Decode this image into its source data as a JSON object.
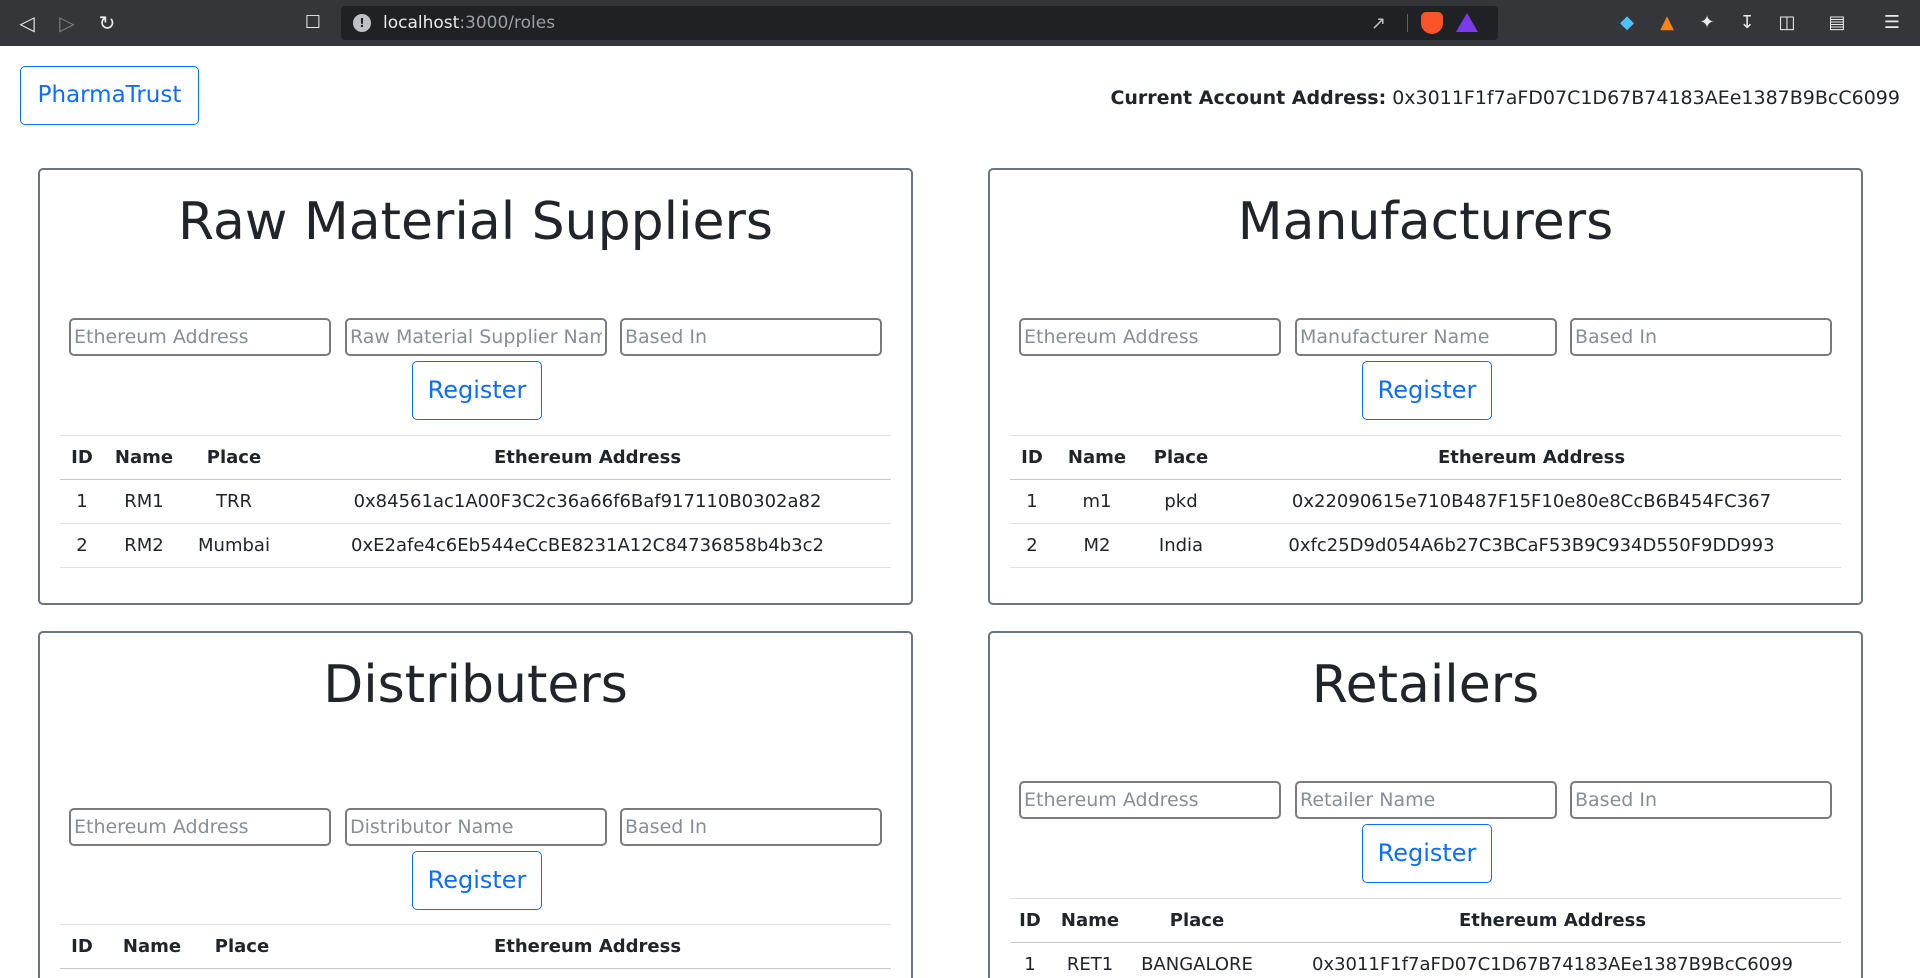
{
  "browser": {
    "url_host": "localhost",
    "url_path": ":3000/roles"
  },
  "header": {
    "brand": "PharmaTrust",
    "account_label": "Current Account Address:",
    "account_value": "0x3011F1f7aFD07C1D67B74183AEe1387B9BcC6099"
  },
  "sections": {
    "suppliers": {
      "title": "Raw Material Suppliers",
      "placeholders": [
        "Ethereum Address",
        "Raw Material Supplier Name",
        "Based In"
      ],
      "register": "Register",
      "headers": [
        "ID",
        "Name",
        "Place",
        "Ethereum Address"
      ],
      "rows": [
        [
          "1",
          "RM1",
          "TRR",
          "0x84561ac1A00F3C2c36a66f6Baf917110B0302a82"
        ],
        [
          "2",
          "RM2",
          "Mumbai",
          "0xE2afe4c6Eb544eCcBE8231A12C84736858b4b3c2"
        ]
      ]
    },
    "manufacturers": {
      "title": "Manufacturers",
      "placeholders": [
        "Ethereum Address",
        "Manufacturer Name",
        "Based In"
      ],
      "register": "Register",
      "headers": [
        "ID",
        "Name",
        "Place",
        "Ethereum Address"
      ],
      "rows": [
        [
          "1",
          "m1",
          "pkd",
          "0x22090615e710B487F15F10e80e8CcB6B454FC367"
        ],
        [
          "2",
          "M2",
          "India",
          "0xfc25D9d054A6b27C3BCaF53B9C934D550F9DD993"
        ]
      ]
    },
    "distributers": {
      "title": "Distributers",
      "placeholders": [
        "Ethereum Address",
        "Distributor Name",
        "Based In"
      ],
      "register": "Register",
      "headers": [
        "ID",
        "Name",
        "Place",
        "Ethereum Address"
      ],
      "rows": []
    },
    "retailers": {
      "title": "Retailers",
      "placeholders": [
        "Ethereum Address",
        "Retailer Name",
        "Based In"
      ],
      "register": "Register",
      "headers": [
        "ID",
        "Name",
        "Place",
        "Ethereum Address"
      ],
      "rows": [
        [
          "1",
          "RET1",
          "BANGALORE",
          "0x3011F1f7aFD07C1D67B74183AEe1387B9BcC6099"
        ]
      ]
    }
  }
}
